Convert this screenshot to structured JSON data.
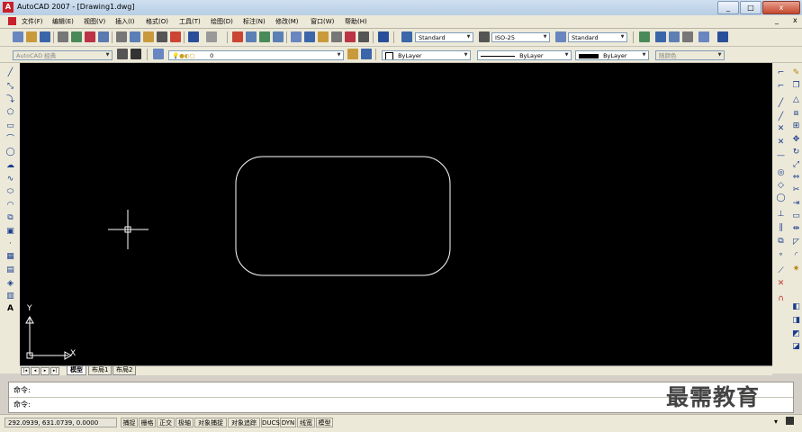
{
  "window": {
    "title": "AutoCAD 2007 - [Drawing1.dwg]",
    "minimize": "_",
    "maximize": "□",
    "close": "x"
  },
  "menu": [
    "文件(F)",
    "编辑(E)",
    "视图(V)",
    "插入(I)",
    "格式(O)",
    "工具(T)",
    "绘图(D)",
    "标注(N)",
    "修改(M)",
    "窗口(W)",
    "帮助(H)"
  ],
  "toolbar": {
    "text_style": "Standard",
    "dim_style": "ISO-25",
    "table_style": "Standard",
    "workspace": "AutoCAD 经典",
    "layer": "0",
    "color": "ByLayer",
    "linetype": "ByLayer",
    "lineweight": "ByLayer",
    "plotstyle": "随颜色"
  },
  "left_tools": [
    "line-icon",
    "xline-icon",
    "polyline-icon",
    "polygon-icon",
    "rectangle-icon",
    "arc-icon",
    "circle-icon",
    "revcloud-icon",
    "spline-icon",
    "ellipse-icon",
    "ellipse-arc-icon",
    "insert-block-icon",
    "make-block-icon",
    "point-icon",
    "hatch-icon",
    "gradient-icon",
    "region-icon",
    "table-icon",
    "mtext-icon"
  ],
  "right_tools": [
    "erase-icon",
    "copy-icon",
    "mirror-icon",
    "offset-icon",
    "array-icon",
    "move-icon",
    "rotate-icon",
    "scale-icon",
    "stretch-icon",
    "trim-icon",
    "extend-icon",
    "break-icon",
    "join-icon",
    "chamfer-icon",
    "fillet-icon",
    "explode-icon"
  ],
  "ucs": {
    "x_label": "X",
    "y_label": "Y"
  },
  "tabs": {
    "model": "模型",
    "layout1": "布局1",
    "layout2": "布局2"
  },
  "command": {
    "line1": "命令:",
    "line2": "命令:"
  },
  "status": {
    "coords": "292.0939,  631.0739, 0.0000",
    "buttons": [
      "捕捉",
      "栅格",
      "正交",
      "极轴",
      "对象捕捉",
      "对象追踪",
      "DUCS",
      "DYN",
      "线宽",
      "模型"
    ]
  },
  "watermark": "最需教育"
}
